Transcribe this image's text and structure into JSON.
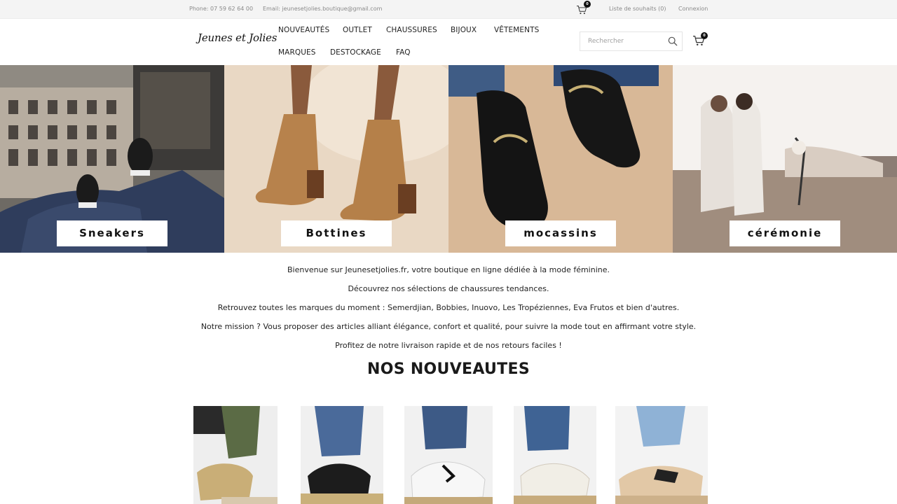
{
  "topbar": {
    "phone": "Phone: 07 59 62 64 00",
    "email": "Email: jeunesetjolies.boutique@gmail.com",
    "cart_badge": "0",
    "wishlist": "Liste de souhaits (0)",
    "login": "Connexion"
  },
  "header": {
    "logo": "Jeunes et Jolies",
    "nav": [
      "NOUVEAUTÉS",
      "OUTLET",
      "CHAUSSURES",
      "BIJOUX",
      "VÊTEMENTS",
      "MARQUES",
      "DESTOCKAGE",
      "FAQ"
    ],
    "search_placeholder": "Rechercher",
    "cart_badge": "0"
  },
  "categories": [
    "Sneakers",
    "Bottines",
    "mocassins",
    "cérémonie"
  ],
  "intro": [
    "Bienvenue sur Jeunesetjolies.fr, votre boutique en ligne dédiée à la mode féminine.",
    "Découvrez nos sélections de chaussures tendances.",
    "Retrouvez toutes les marques du moment : Semerdjian, Bobbies, Inuovo, Les Tropéziennes, Eva Frutos et bien d'autres.",
    "Notre mission ? Vous proposer des articles alliant élégance, confort et qualité, pour suivre la mode tout en affirmant votre style.",
    "Profitez de notre livraison rapide et de nos retours faciles !"
  ],
  "section_title": "NOS NOUVEAUTES",
  "icons": {
    "cart": "cart-icon",
    "search": "search-icon"
  },
  "colors": {
    "topbar_bg": "#f4f4f4",
    "text": "#222222",
    "badge": "#111111"
  }
}
